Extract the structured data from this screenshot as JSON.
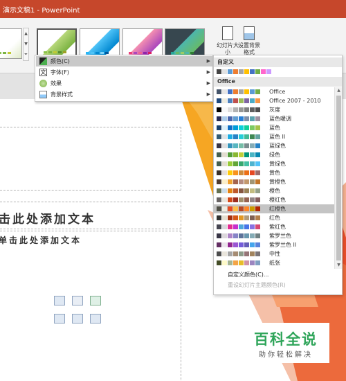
{
  "window": {
    "title": "演示文稿1 - PowerPoint"
  },
  "ribbon": {
    "slide_size_label": "幻灯片大小",
    "background_format_label": "设置背景格式",
    "theme_variants": [
      {
        "name": "variant-1",
        "bar_colors": [
          "#8bc34a",
          "#7cb342",
          "#c0ca33",
          "#558b2f",
          "#9e9d24"
        ]
      },
      {
        "name": "variant-2",
        "bar_colors": [
          "#29b6f6",
          "#4fc3f7",
          "#0288d1",
          "#81d4fa",
          "#01579b"
        ]
      },
      {
        "name": "variant-3",
        "bar_colors": [
          "#ec407a",
          "#ab47bc",
          "#f06292",
          "#8e24aa",
          "#d81b60"
        ]
      },
      {
        "name": "variant-4",
        "bar_colors": [
          "#26a69a",
          "#66bb6a",
          "#9ccc65",
          "#4db6ac",
          "#2e7d32"
        ]
      }
    ]
  },
  "menu": {
    "items": [
      {
        "label": "颜色(C)",
        "icon": "colors-icon"
      },
      {
        "label": "字体(F)",
        "icon": "font-icon"
      },
      {
        "label": "效果",
        "icon": "effects-icon"
      },
      {
        "label": "背景样式",
        "icon": "background-style-icon"
      }
    ]
  },
  "colors_panel": {
    "custom_header": "自定义",
    "office_header": "Office",
    "custom_swatches": [
      "#444444",
      "#e2e2e2",
      "#5b9bd5",
      "#ed7d31",
      "#a5a5a5",
      "#ffc000",
      "#4472c4",
      "#70ad47",
      "#ff66cc",
      "#cc99ff"
    ],
    "schemes": [
      {
        "name": "Office",
        "colors": [
          "#44546a",
          "#e7e6e6",
          "#4472c4",
          "#ed7d31",
          "#a5a5a5",
          "#ffc000",
          "#5b9bd5",
          "#70ad47"
        ]
      },
      {
        "name": "Office 2007 - 2010",
        "colors": [
          "#1f497d",
          "#eeece1",
          "#4f81bd",
          "#c0504d",
          "#9bbb59",
          "#8064a2",
          "#4bacc6",
          "#f79646"
        ]
      },
      {
        "name": "灰度",
        "colors": [
          "#000000",
          "#f8f8f8",
          "#dddddd",
          "#b2b2b2",
          "#969696",
          "#808080",
          "#5f5f5f",
          "#4d4d4d"
        ]
      },
      {
        "name": "蓝色暖调",
        "colors": [
          "#242852",
          "#acccea",
          "#4a66ac",
          "#629dd1",
          "#297fd5",
          "#7f8fa9",
          "#5aa2ae",
          "#9d90a0"
        ]
      },
      {
        "name": "蓝色",
        "colors": [
          "#17406d",
          "#dbeff9",
          "#0f6fc6",
          "#009dd9",
          "#0bd0d9",
          "#10cf9b",
          "#7cca62",
          "#a5c249"
        ]
      },
      {
        "name": "蓝色 II",
        "colors": [
          "#335b74",
          "#dfe3e5",
          "#1cade4",
          "#2683c6",
          "#27ced7",
          "#42ba97",
          "#3e8853",
          "#62a39f"
        ]
      },
      {
        "name": "蓝绿色",
        "colors": [
          "#373545",
          "#dedede",
          "#3494ba",
          "#58b6c0",
          "#75bda7",
          "#7a8c8e",
          "#84acb6",
          "#2683c6"
        ]
      },
      {
        "name": "绿色",
        "colors": [
          "#455f51",
          "#e3ded1",
          "#549e39",
          "#8ab833",
          "#c0cf3a",
          "#029676",
          "#4ab5c4",
          "#0989b1"
        ]
      },
      {
        "name": "黄绿色",
        "colors": [
          "#455f51",
          "#e3ded1",
          "#99cb38",
          "#63a537",
          "#37a76f",
          "#44c1a3",
          "#4eb3cf",
          "#51c3f9"
        ]
      },
      {
        "name": "黄色",
        "colors": [
          "#39302a",
          "#e5dedb",
          "#ffca08",
          "#f8931d",
          "#ce8d3e",
          "#ec7016",
          "#e64823",
          "#9c6a6a"
        ]
      },
      {
        "name": "黄橙色",
        "colors": [
          "#4e3b30",
          "#fbeec9",
          "#f0a22e",
          "#a5644e",
          "#b58b80",
          "#c3986d",
          "#a19574",
          "#c17529"
        ]
      },
      {
        "name": "橙色",
        "colors": [
          "#637052",
          "#ccddea",
          "#e48312",
          "#bd582c",
          "#865640",
          "#9b8357",
          "#c2bc80",
          "#94a088"
        ]
      },
      {
        "name": "橙红色",
        "colors": [
          "#696464",
          "#e9e5dc",
          "#d34817",
          "#9b2d1f",
          "#a28e6a",
          "#956251",
          "#918485",
          "#855d5d"
        ]
      },
      {
        "name": "红橙色",
        "colors": [
          "#505046",
          "#eeece1",
          "#e84c22",
          "#ffbd47",
          "#b64926",
          "#ff8427",
          "#cc9900",
          "#b22600"
        ]
      },
      {
        "name": "红色",
        "colors": [
          "#323232",
          "#e3ded1",
          "#a5300f",
          "#d55816",
          "#e19825",
          "#b19c7d",
          "#7f5f52",
          "#b27d49"
        ]
      },
      {
        "name": "紫红色",
        "colors": [
          "#454551",
          "#d8d9dc",
          "#e32d91",
          "#c830cc",
          "#4ea6dc",
          "#4775e7",
          "#8971e1",
          "#d54773"
        ]
      },
      {
        "name": "紫罗兰色",
        "colors": [
          "#373545",
          "#dcd8dc",
          "#ad84c6",
          "#8784c7",
          "#5d739a",
          "#6997af",
          "#84acb6",
          "#6f8183"
        ]
      },
      {
        "name": "紫罗兰色 II",
        "colors": [
          "#632e62",
          "#eae5eb",
          "#92278f",
          "#9b57d3",
          "#755dd9",
          "#665eb8",
          "#45a5ed",
          "#5982db"
        ]
      },
      {
        "name": "中性",
        "colors": [
          "#4d4d4d",
          "#e9e5dc",
          "#a5a5a5",
          "#a58c73",
          "#8c9b89",
          "#957577",
          "#a2845d",
          "#7b7577"
        ]
      },
      {
        "name": "纸张",
        "colors": [
          "#444d26",
          "#fefac9",
          "#a5b592",
          "#f3a447",
          "#e7bc29",
          "#d092a7",
          "#9c85c0",
          "#809ec2"
        ]
      }
    ],
    "selected_index": 13,
    "custom_colors_label": "自定义颜色(C)...",
    "reset_label": "重设幻灯片主题颜色(R)"
  },
  "slide": {
    "title_placeholder": "击此处添加文本",
    "body_placeholder": "单击此处添加文本"
  },
  "watermark": {
    "brand": "百科全说",
    "tagline": "助你轻松解决"
  }
}
